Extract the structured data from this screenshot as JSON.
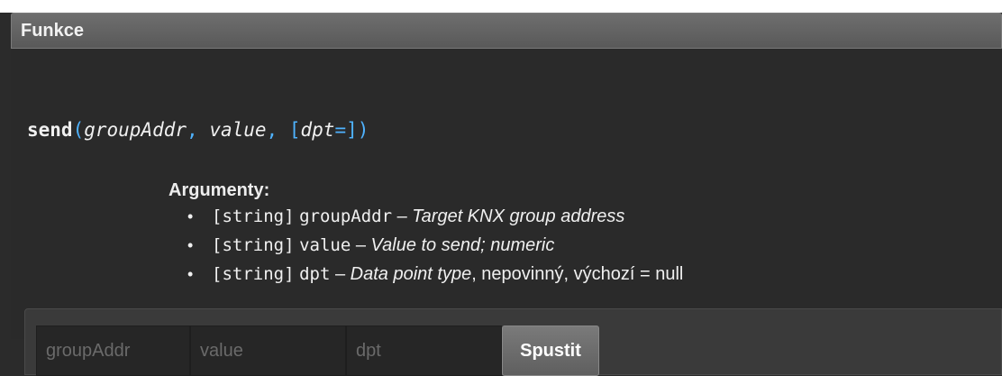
{
  "panel": {
    "title": "Funkce"
  },
  "signature": {
    "name": "send",
    "open": "(",
    "arg1": "groupAddr",
    "sep1": ", ",
    "arg2": "value",
    "sep2": ", ",
    "arg3_open": "[",
    "arg3": "dpt",
    "arg3_eq": "=",
    "arg3_close": "]",
    "close": ")"
  },
  "arguments": {
    "title": "Argumenty:",
    "items": [
      {
        "type": "[string]",
        "name": "groupAddr",
        "dash": " – ",
        "desc": "Target KNX group address",
        "extra": ""
      },
      {
        "type": "[string]",
        "name": "value",
        "dash": " – ",
        "desc": "Value to send; numeric",
        "extra": ""
      },
      {
        "type": "[string]",
        "name": "dpt",
        "dash": " – ",
        "desc": "Data point type",
        "extra": ", nepovinný, výchozí = null"
      }
    ]
  },
  "form": {
    "groupAddr_placeholder": "groupAddr",
    "value_placeholder": "value",
    "dpt_placeholder": "dpt",
    "run_label": "Spustit"
  }
}
